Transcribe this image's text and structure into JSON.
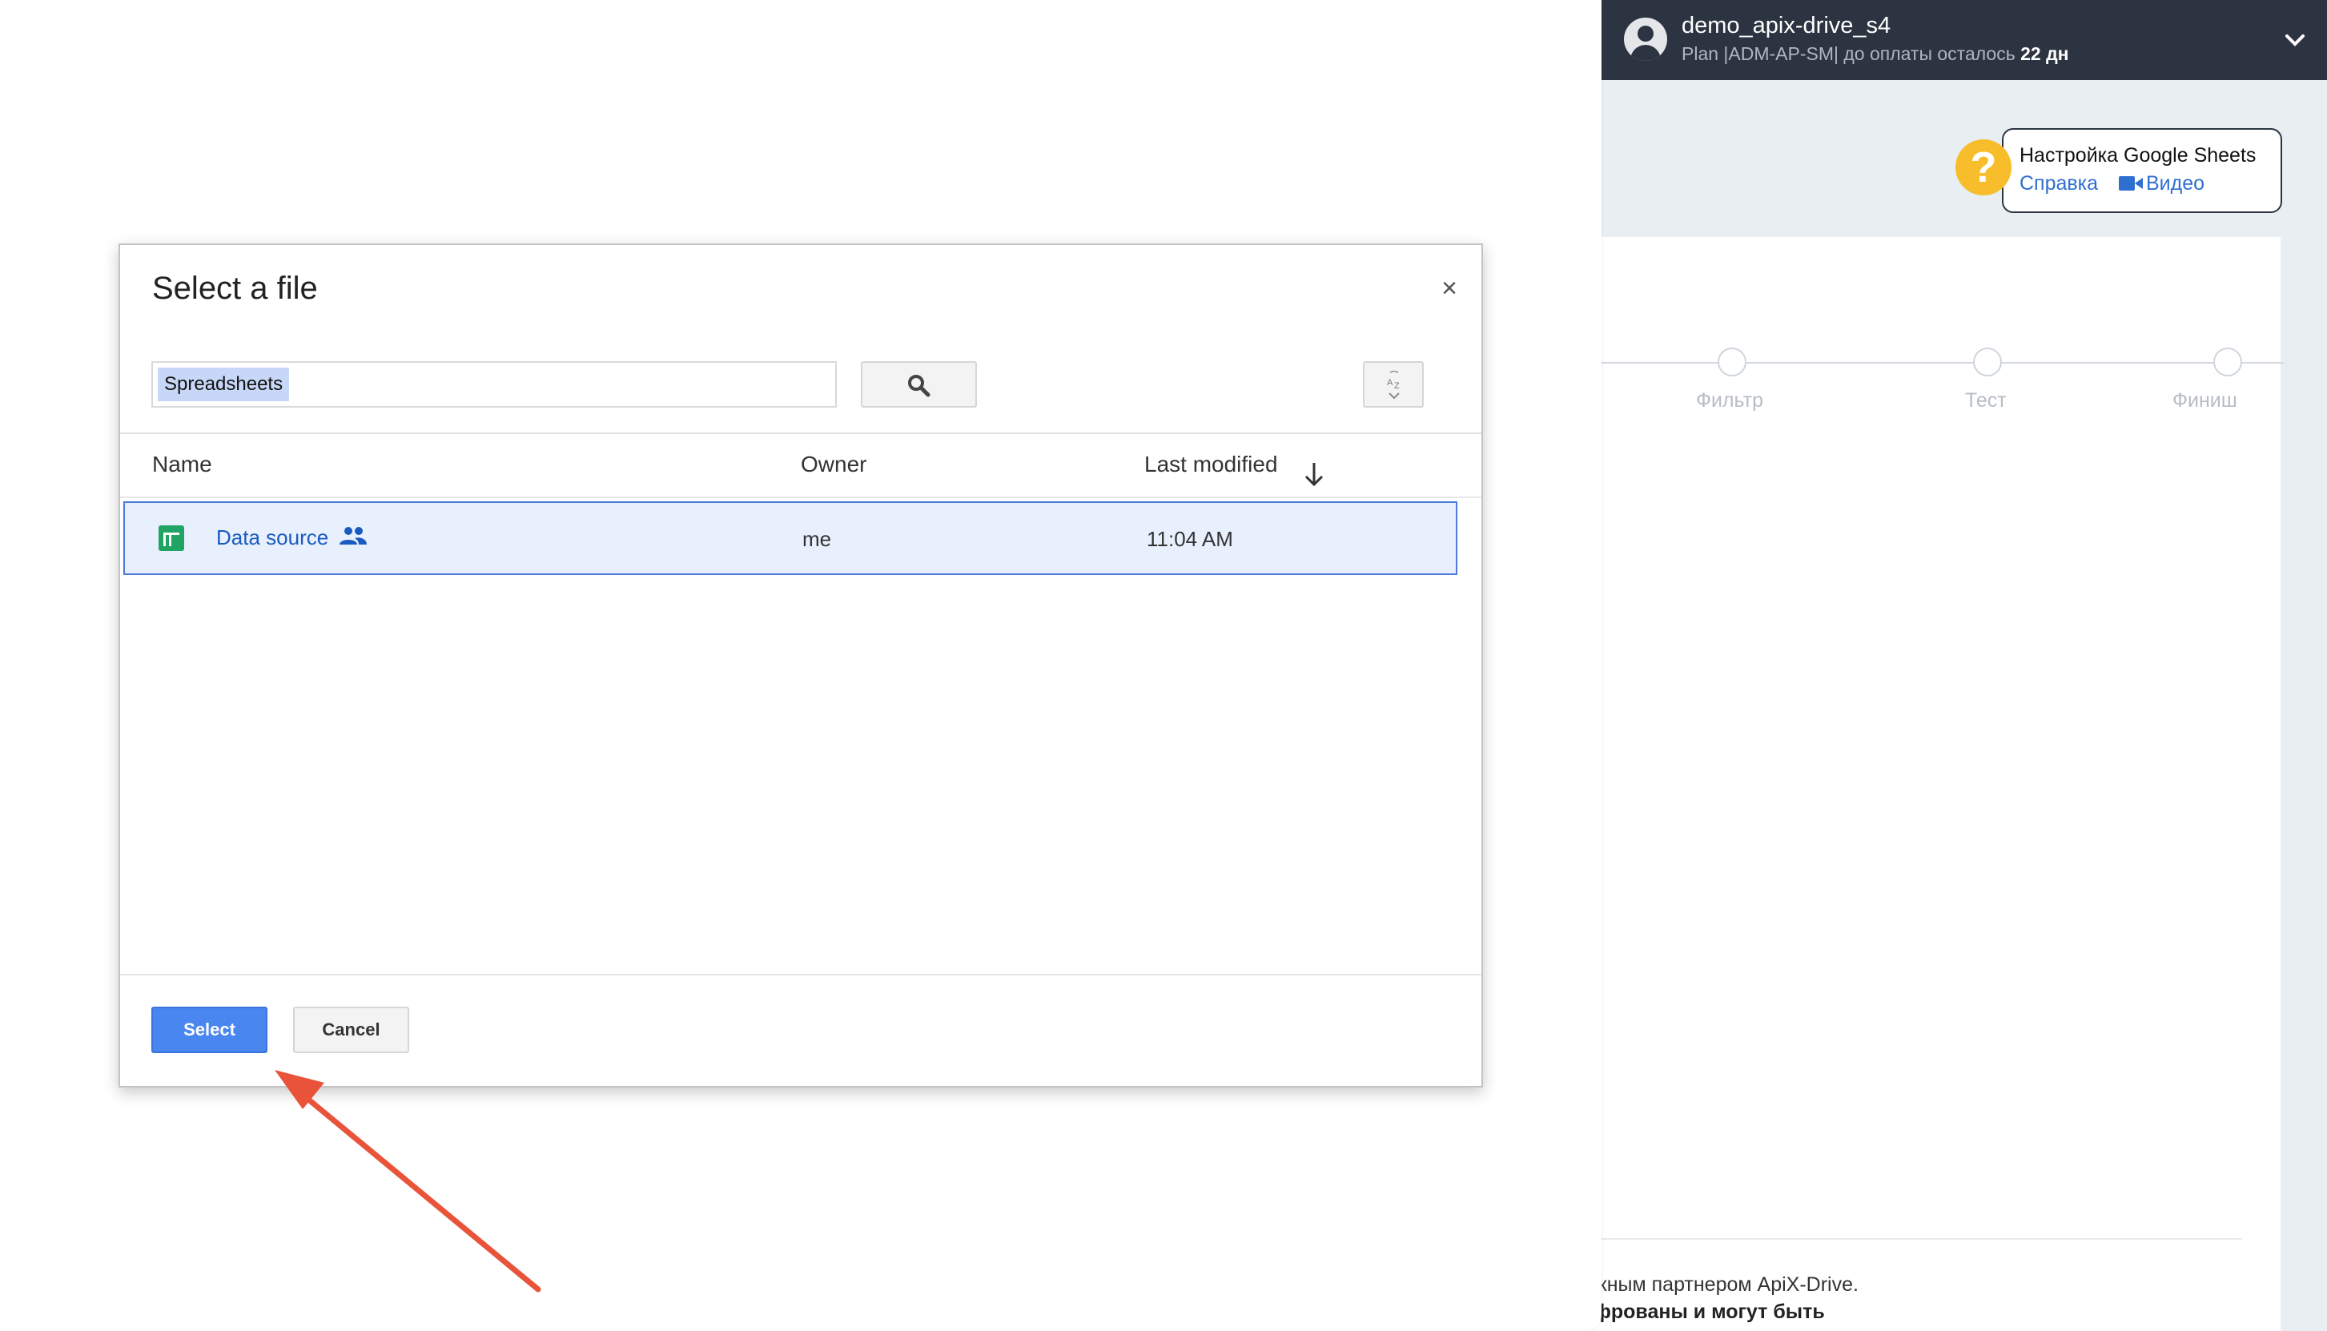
{
  "app": {
    "account": {
      "name": "demo_apix-drive_s4",
      "plan_prefix": "Plan |ADM-AP-SM| до оплаты осталось ",
      "days_left": "22 дн"
    },
    "help": {
      "icon_symbol": "?",
      "title": "Настройка Google Sheets",
      "link": "Справка",
      "video": "Видео",
      "icon_color": "#f7bd2a"
    },
    "steps": [
      "Фильтр",
      "Тест",
      "Финиш"
    ],
    "footer": {
      "line1": "жным партнером ApiX-Drive.",
      "line2": "фрованы и могут быть"
    },
    "colors": {
      "topbar": "#2c3441",
      "link": "#2f6fd0"
    }
  },
  "picker": {
    "title": "Select a file",
    "close_symbol": "×",
    "search": {
      "query": "Spreadsheets"
    },
    "columns": {
      "name": "Name",
      "owner": "Owner",
      "modified": "Last modified"
    },
    "files": [
      {
        "name": "Data source",
        "owner": "me",
        "modified": "11:04 AM",
        "shared": true,
        "type_icon": "google-sheets-icon"
      }
    ],
    "buttons": {
      "select": "Select",
      "cancel": "Cancel"
    },
    "colors": {
      "select_button": "#4a86f0",
      "selected_row": "#e8f0fe",
      "arrow": "#e8533a"
    }
  }
}
